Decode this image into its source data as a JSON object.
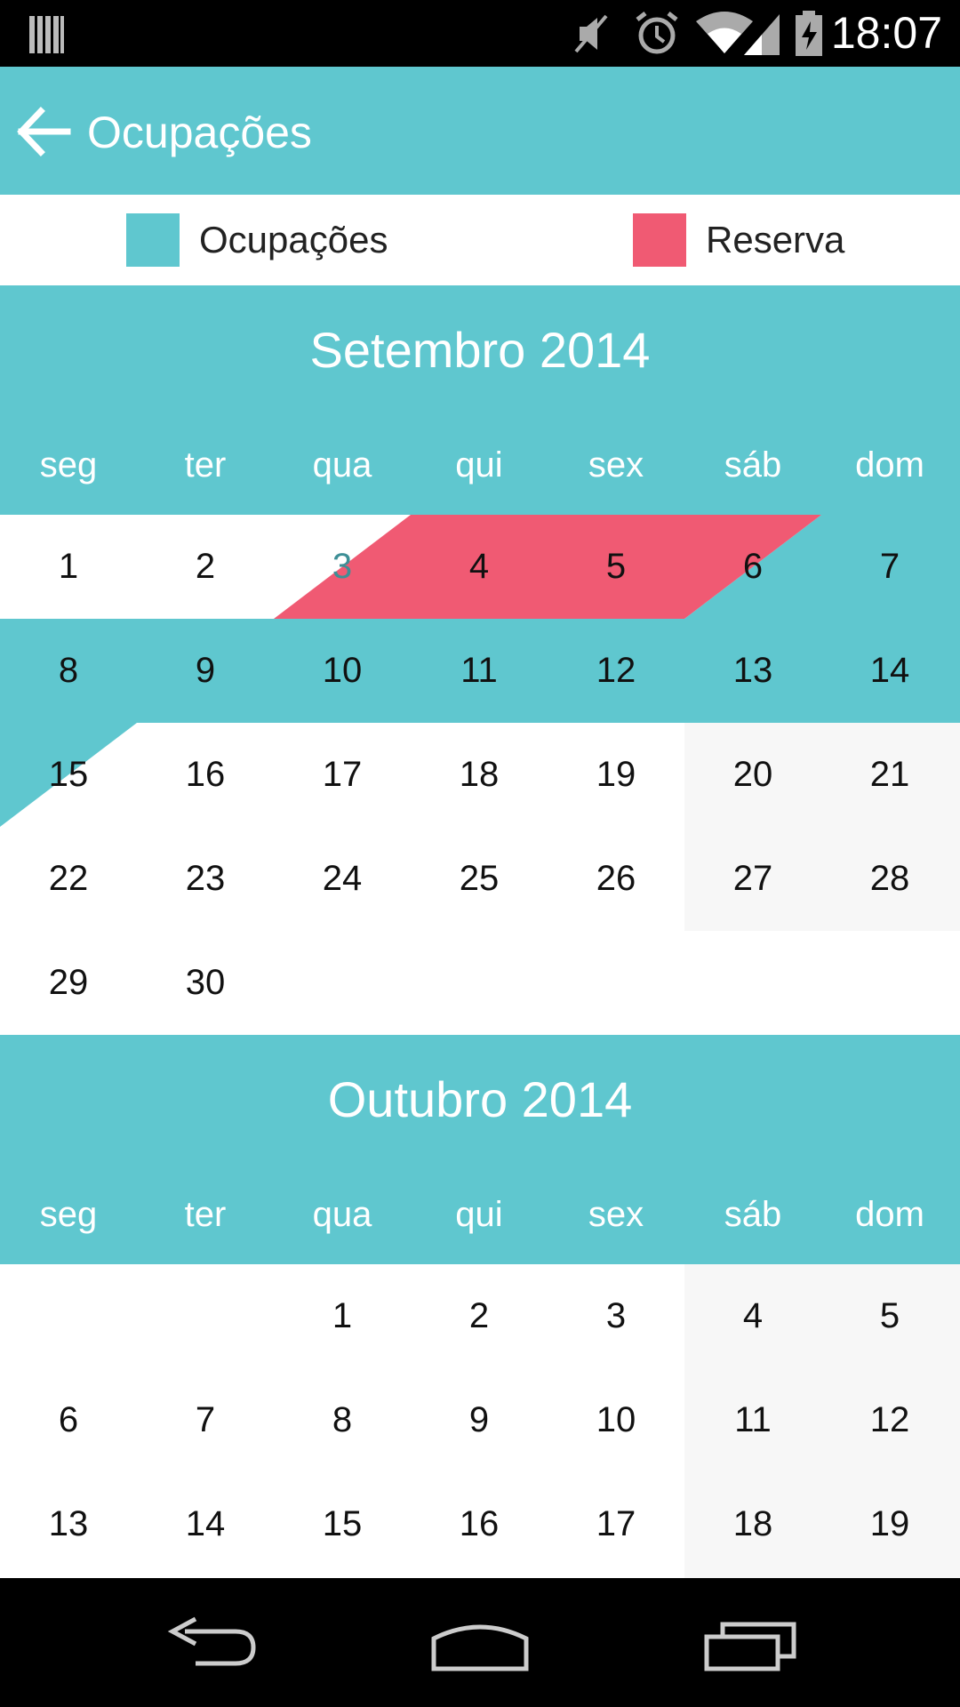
{
  "status_bar": {
    "time": "18:07",
    "icons": [
      "barcode-icon",
      "mute-icon",
      "alarm-icon",
      "wifi-icon",
      "signal-icon",
      "battery-charging-icon"
    ]
  },
  "app_bar": {
    "back_icon": "back-arrow-icon",
    "title": "Ocupações"
  },
  "legend": [
    {
      "label": "Ocupações",
      "color": "#5fc7cf"
    },
    {
      "label": "Reserva",
      "color": "#f05a73"
    }
  ],
  "weekdays": [
    "seg",
    "ter",
    "qua",
    "qui",
    "sex",
    "sáb",
    "dom"
  ],
  "months": [
    {
      "title": "Setembro 2014",
      "days": [
        [
          "1",
          "2",
          "3",
          "4",
          "5",
          "6",
          "7"
        ],
        [
          "8",
          "9",
          "10",
          "11",
          "12",
          "13",
          "14"
        ],
        [
          "15",
          "16",
          "17",
          "18",
          "19",
          "20",
          "21"
        ],
        [
          "22",
          "23",
          "24",
          "25",
          "26",
          "27",
          "28"
        ],
        [
          "29",
          "30",
          "",
          "",
          "",
          "",
          ""
        ]
      ]
    },
    {
      "title": "Outubro 2014",
      "days": [
        [
          "",
          "",
          "1",
          "2",
          "3",
          "4",
          "5"
        ],
        [
          "6",
          "7",
          "8",
          "9",
          "10",
          "11",
          "12"
        ],
        [
          "13",
          "14",
          "15",
          "16",
          "17",
          "18",
          "19"
        ]
      ]
    }
  ],
  "colors": {
    "accent": "#5fc7cf",
    "reserva": "#f05a73",
    "weekend_bg": "#f7f7f7",
    "highlight_text": "#3d8f96"
  },
  "nav_bar": {
    "icons": [
      "back-nav-icon",
      "home-nav-icon",
      "recents-nav-icon"
    ]
  }
}
